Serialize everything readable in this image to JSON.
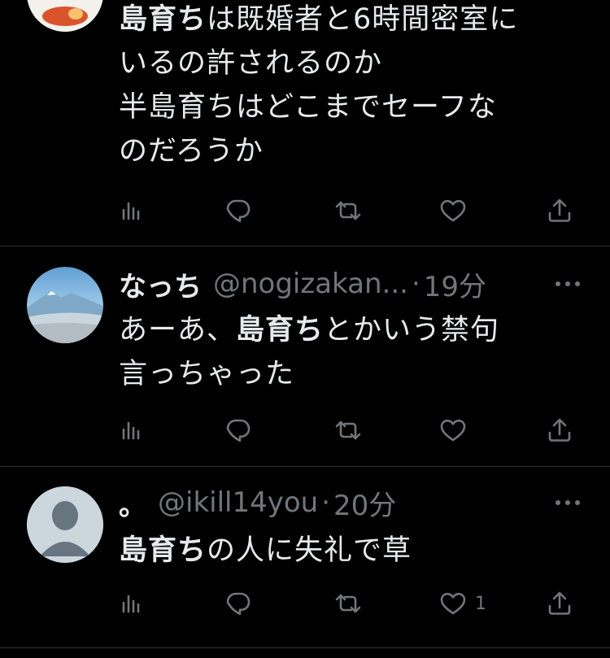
{
  "tweets": [
    {
      "text_lines": [
        [
          {
            "t": "島育ち",
            "b": true
          },
          {
            "t": "は既婚者と6時間密室に",
            "b": false
          }
        ],
        [
          {
            "t": "いるの許されるのか",
            "b": false
          }
        ],
        [
          {
            "t": "半島育ちはどこまでセーフな",
            "b": false
          }
        ],
        [
          {
            "t": "のだろうか",
            "b": false
          }
        ]
      ],
      "like_count": ""
    },
    {
      "name": "なっち",
      "handle": "@nogizakan...",
      "separator": "·",
      "time": "19分",
      "text_lines": [
        [
          {
            "t": "あーあ、",
            "b": false
          },
          {
            "t": "島育ち",
            "b": true
          },
          {
            "t": "とかいう禁句",
            "b": false
          }
        ],
        [
          {
            "t": "言っちゃった",
            "b": false
          }
        ]
      ],
      "like_count": ""
    },
    {
      "name": "。",
      "handle": "@ikill14you",
      "separator": "·",
      "time": "20分",
      "text_lines": [
        [
          {
            "t": "島育ち",
            "b": true
          },
          {
            "t": "の人に失礼で草",
            "b": false
          }
        ]
      ],
      "like_count": "1"
    }
  ],
  "icons": {
    "more": "more-icon",
    "views": "views-icon",
    "reply": "reply-icon",
    "retweet": "retweet-icon",
    "like": "like-icon",
    "share": "share-icon"
  },
  "colors": {
    "background": "#000000",
    "text": "#e7e9ea",
    "secondary": "#71767b",
    "divider": "#2f3336"
  }
}
